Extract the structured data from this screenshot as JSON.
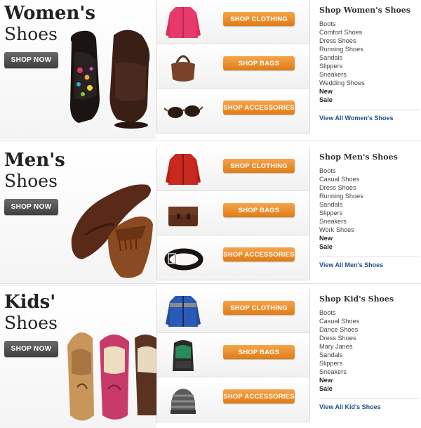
{
  "sections": [
    {
      "title_line1": "Women's",
      "title_line2": "Shoes",
      "shop_now": "SHOP NOW",
      "categories": [
        {
          "label": "SHOP CLOTHING",
          "icon": "jacket-pink-icon"
        },
        {
          "label": "SHOP BAGS",
          "icon": "handbag-brown-icon"
        },
        {
          "label": "SHOP ACCESSORIES",
          "icon": "sunglasses-icon"
        }
      ],
      "links_title": "Shop Women's Shoes",
      "links": [
        "Boots",
        "Comfort Shoes",
        "Dress Shoes",
        "Running Shoes",
        "Sandals",
        "Slippers",
        "Sneakers",
        "Wedding Shoes"
      ],
      "bold_links": [
        "New",
        "Sale"
      ],
      "view_all": "View All Women's Shoes"
    },
    {
      "title_line1": "Men's",
      "title_line2": "Shoes",
      "shop_now": "SHOP NOW",
      "categories": [
        {
          "label": "SHOP CLOTHING",
          "icon": "jacket-red-icon"
        },
        {
          "label": "SHOP BAGS",
          "icon": "messenger-bag-icon"
        },
        {
          "label": "SHOP ACCESSORIES",
          "icon": "belt-icon"
        }
      ],
      "links_title": "Shop Men's Shoes",
      "links": [
        "Boots",
        "Casual Shoes",
        "Dress Shoes",
        "Running Shoes",
        "Sandals",
        "Slippers",
        "Sneakers",
        "Work Shoes"
      ],
      "bold_links": [
        "New",
        "Sale"
      ],
      "view_all": "View All Men's Shoes"
    },
    {
      "title_line1": "Kids'",
      "title_line2": "Shoes",
      "shop_now": "SHOP NOW",
      "categories": [
        {
          "label": "SHOP CLOTHING",
          "icon": "kids-jacket-icon"
        },
        {
          "label": "SHOP BAGS",
          "icon": "backpack-icon"
        },
        {
          "label": "SHOP ACCESSORIES",
          "icon": "beanie-icon"
        }
      ],
      "links_title": "Shop Kid's Shoes",
      "links": [
        "Boots",
        "Casual Shoes",
        "Dance Shoes",
        "Dress Shoes",
        "Mary Janes",
        "Sandals",
        "Slippers",
        "Sneakers"
      ],
      "bold_links": [
        "New",
        "Sale"
      ],
      "view_all": "View All Kid's Shoes"
    }
  ],
  "colors": {
    "shop_button": "#e88a22",
    "shop_now_button": "#4f4f4f",
    "view_all_link": "#1d4f8a"
  }
}
